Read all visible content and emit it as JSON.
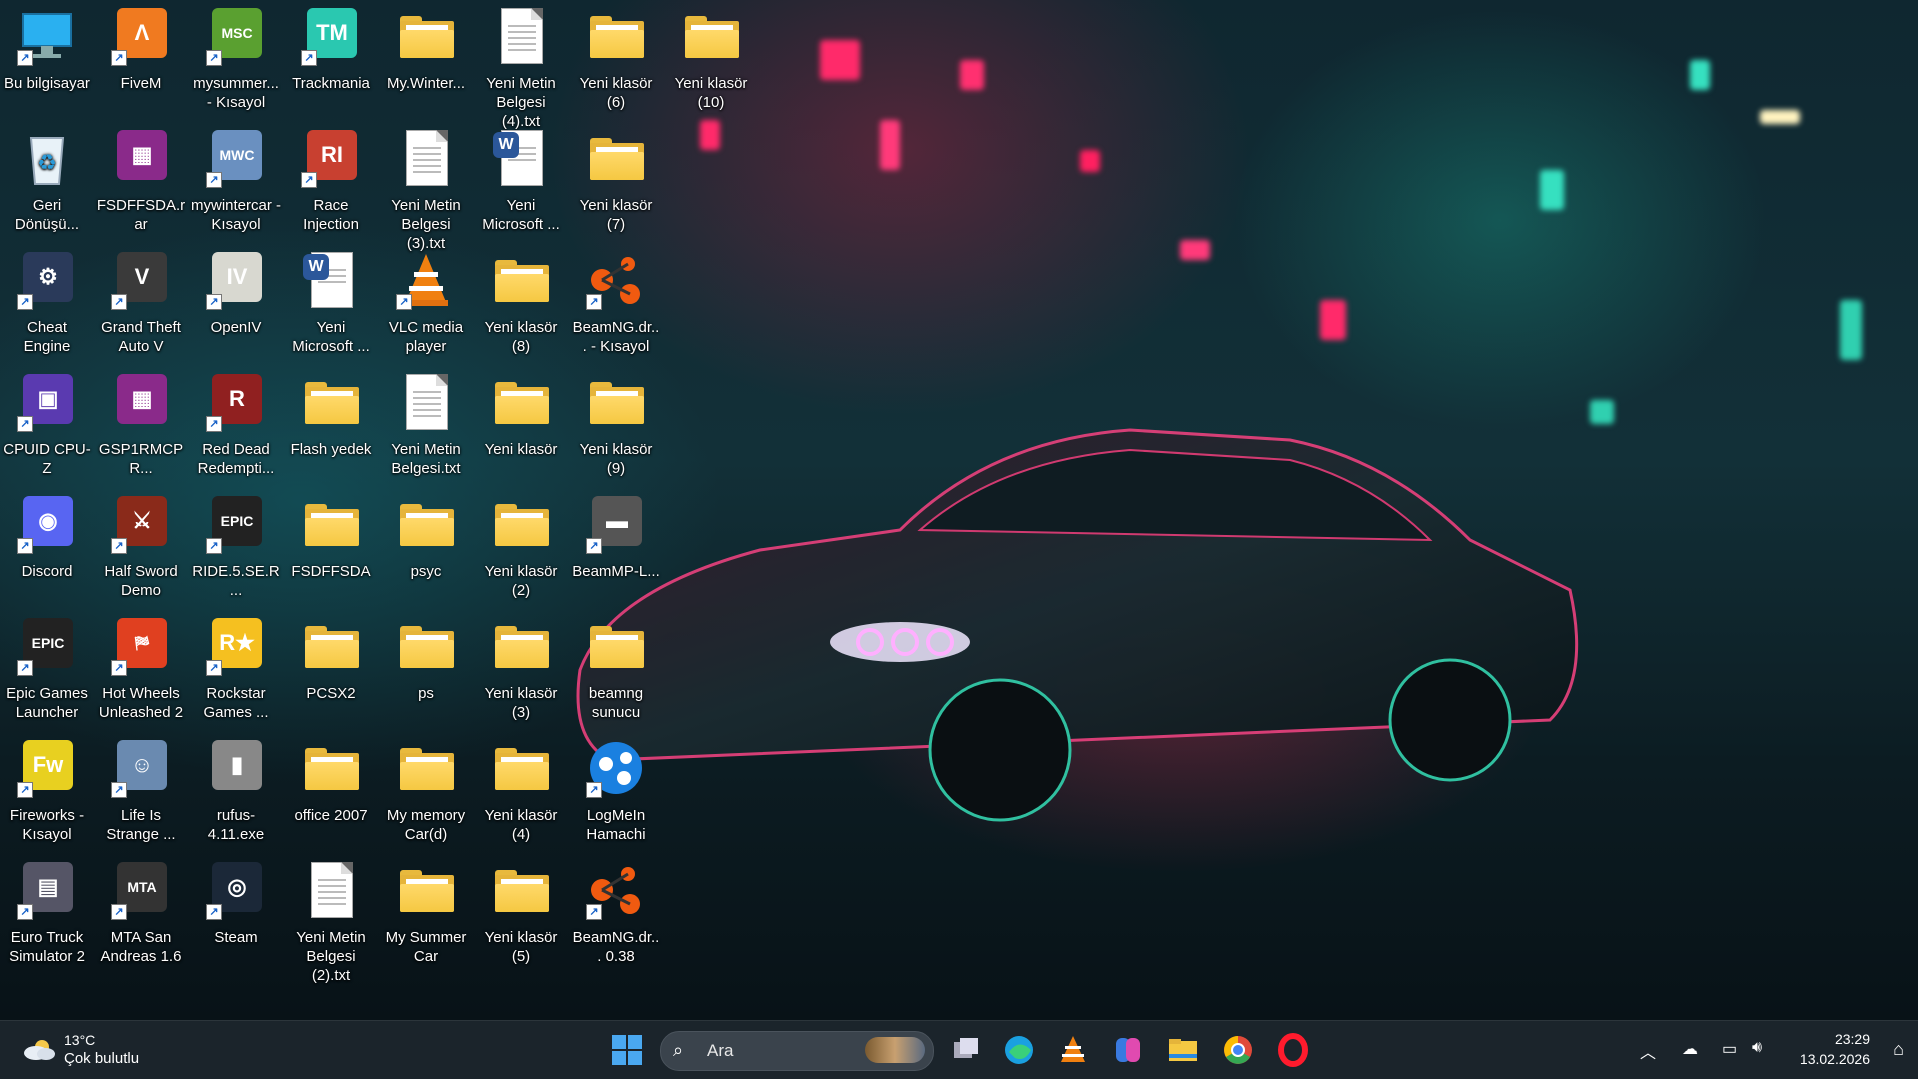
{
  "desktop": {
    "icons": [
      {
        "label": "Bu bilgisayar",
        "icon": "this-pc-icon"
      },
      {
        "label": "FiveM",
        "icon": "fivem-icon"
      },
      {
        "label": "mysummer... - Kısayol",
        "icon": "mysummercar-icon"
      },
      {
        "label": "Trackmania",
        "icon": "trackmania-icon"
      },
      {
        "label": "My.Winter...",
        "icon": "folder-icon"
      },
      {
        "label": "Yeni Metin Belgesi (4).txt",
        "icon": "text-file-icon"
      },
      {
        "label": "Yeni klasör (6)",
        "icon": "folder-icon"
      },
      {
        "label": "Yeni klasör (10)",
        "icon": "folder-icon"
      },
      {
        "label": "Geri Dönüşü...",
        "icon": "recycle-bin-icon"
      },
      {
        "label": "FSDFFSDA.rar",
        "icon": "winrar-icon"
      },
      {
        "label": "mywintercar - Kısayol",
        "icon": "mywintercar-icon"
      },
      {
        "label": "Race Injection",
        "icon": "race-injection-icon"
      },
      {
        "label": "Yeni Metin Belgesi (3).txt",
        "icon": "text-file-icon"
      },
      {
        "label": "Yeni Microsoft ...",
        "icon": "word-doc-icon"
      },
      {
        "label": "Yeni klasör (7)",
        "icon": "folder-icon"
      },
      {
        "label": "Cheat Engine",
        "icon": "cheat-engine-icon"
      },
      {
        "label": "Grand Theft Auto V",
        "icon": "gta5-icon"
      },
      {
        "label": "OpenIV",
        "icon": "openiv-icon"
      },
      {
        "label": "Yeni Microsoft ...",
        "icon": "word-doc-icon"
      },
      {
        "label": "VLC media player",
        "icon": "vlc-icon"
      },
      {
        "label": "Yeni klasör (8)",
        "icon": "folder-icon"
      },
      {
        "label": "BeamNG.dr... - Kısayol",
        "icon": "beamng-icon"
      },
      {
        "label": "CPUID CPU-Z",
        "icon": "cpuz-icon"
      },
      {
        "label": "GSP1RMCPR...",
        "icon": "winrar-icon"
      },
      {
        "label": "Red Dead Redempti...",
        "icon": "rdr2-icon"
      },
      {
        "label": "Flash yedek",
        "icon": "folder-icon"
      },
      {
        "label": "Yeni Metin Belgesi.txt",
        "icon": "text-file-icon"
      },
      {
        "label": "Yeni klasör",
        "icon": "folder-icon"
      },
      {
        "label": "Yeni klasör (9)",
        "icon": "folder-icon"
      },
      {
        "label": "Discord",
        "icon": "discord-icon"
      },
      {
        "label": "Half Sword Demo",
        "icon": "half-sword-icon"
      },
      {
        "label": "RIDE.5.SE.R...",
        "icon": "epic-games-icon"
      },
      {
        "label": "FSDFFSDA",
        "icon": "folder-icon"
      },
      {
        "label": "psyc",
        "icon": "folder-icon"
      },
      {
        "label": "Yeni klasör (2)",
        "icon": "folder-icon"
      },
      {
        "label": "BeamMP-L...",
        "icon": "beammp-icon"
      },
      {
        "label": "Epic Games Launcher",
        "icon": "epic-games-icon"
      },
      {
        "label": "Hot Wheels Unleashed 2",
        "icon": "hot-wheels-icon"
      },
      {
        "label": "Rockstar Games ...",
        "icon": "rockstar-icon"
      },
      {
        "label": "PCSX2",
        "icon": "folder-icon"
      },
      {
        "label": "ps",
        "icon": "folder-icon"
      },
      {
        "label": "Yeni klasör (3)",
        "icon": "folder-icon"
      },
      {
        "label": "beamng sunucu",
        "icon": "folder-icon"
      },
      {
        "label": "Fireworks - Kısayol",
        "icon": "fireworks-icon"
      },
      {
        "label": "Life Is Strange ...",
        "icon": "life-is-strange-icon"
      },
      {
        "label": "rufus-4.11.exe",
        "icon": "rufus-icon"
      },
      {
        "label": "office 2007",
        "icon": "folder-icon"
      },
      {
        "label": "My memory Car(d)",
        "icon": "folder-icon"
      },
      {
        "label": "Yeni klasör (4)",
        "icon": "folder-icon"
      },
      {
        "label": "LogMeIn Hamachi",
        "icon": "hamachi-icon"
      },
      {
        "label": "Euro Truck Simulator 2",
        "icon": "ets2-icon"
      },
      {
        "label": "MTA San Andreas 1.6",
        "icon": "mta-icon"
      },
      {
        "label": "Steam",
        "icon": "steam-icon"
      },
      {
        "label": "Yeni Metin Belgesi (2).txt",
        "icon": "text-file-icon"
      },
      {
        "label": "My Summer Car",
        "icon": "folder-icon"
      },
      {
        "label": "Yeni klasör (5)",
        "icon": "folder-icon"
      },
      {
        "label": "BeamNG.dr... 0.38",
        "icon": "beamng-icon"
      }
    ]
  },
  "taskbar": {
    "weather": {
      "temp": "13°C",
      "condition": "Çok bulutlu"
    },
    "search": {
      "placeholder": "Ara"
    },
    "apps": [
      "task-view-icon",
      "edge-icon",
      "vlc-icon",
      "copilot-icon",
      "file-explorer-icon",
      "chrome-icon",
      "opera-icon"
    ],
    "clock": {
      "time": "23:29",
      "date": "13.02.2026"
    }
  }
}
